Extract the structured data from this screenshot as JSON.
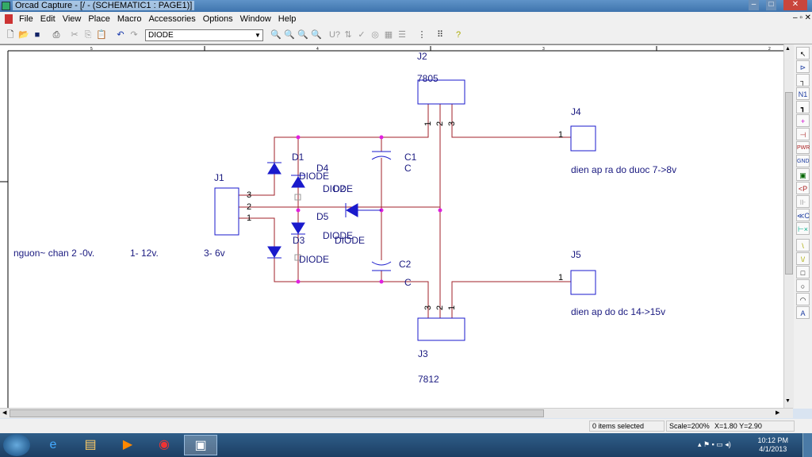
{
  "window": {
    "title": "Orcad Capture - [/ - (SCHEMATIC1 : PAGE1)]"
  },
  "menu": [
    "File",
    "Edit",
    "View",
    "Place",
    "Macro",
    "Accessories",
    "Options",
    "Window",
    "Help"
  ],
  "toolbar": {
    "part_selector": "DIODE",
    "icons": [
      "new-icon",
      "open-icon",
      "save-icon",
      "print-icon",
      "cut-icon",
      "copy-icon",
      "paste-icon",
      "undo-icon",
      "redo-icon"
    ],
    "right_icons": [
      "zoom-in-icon",
      "zoom-out-icon",
      "zoom-area-icon",
      "zoom-all-icon",
      "annotate-icon",
      "back-annotate-icon",
      "drc-icon",
      "netlist-icon",
      "crossref-icon",
      "bom-icon",
      "snap-grid-icon",
      "area-select-icon",
      "help-icon"
    ]
  },
  "ruler": {
    "top": [
      "5",
      "4",
      "3",
      "2"
    ]
  },
  "palette": [
    "↖",
    "⊳",
    "┐",
    "N1",
    "┓",
    "+",
    "⊣",
    "PWR",
    "GND",
    "▣",
    "<P",
    "⊪",
    "≪C",
    "⊢×",
    "\\",
    "\\/",
    "□",
    "○",
    "◠",
    "A"
  ],
  "schematic": {
    "parts": {
      "j1": "J1",
      "j2": "J2",
      "j2_value": "7805",
      "j3": "J3",
      "j3_value": "7812",
      "j4": "J4",
      "j5": "J5",
      "d1": "D1",
      "d2": "D2",
      "d3": "D3",
      "d4": "D4",
      "d5": "D5",
      "diode": "DIODE",
      "c1": "C1",
      "c2": "C2",
      "c": "C"
    },
    "pins": {
      "one": "1",
      "two": "2",
      "three": "3"
    },
    "notes": {
      "input_a": "nguon~ chan 2   -0v.",
      "input_b": "1-   12v.",
      "input_c": "3-    6v",
      "j4_note": "dien ap ra do duoc 7->8v",
      "j5_note": "dien ap do dc 14->15v"
    },
    "colors": {
      "wire": "#a0202a",
      "part": "#1a1acc",
      "junction": "#e020e0"
    }
  },
  "status": {
    "selection": "0 items selected",
    "scale": "Scale=200%",
    "coords": "X=1.80  Y=2.90"
  },
  "taskbar": {
    "time": "10:12 PM",
    "date": "4/1/2013"
  }
}
